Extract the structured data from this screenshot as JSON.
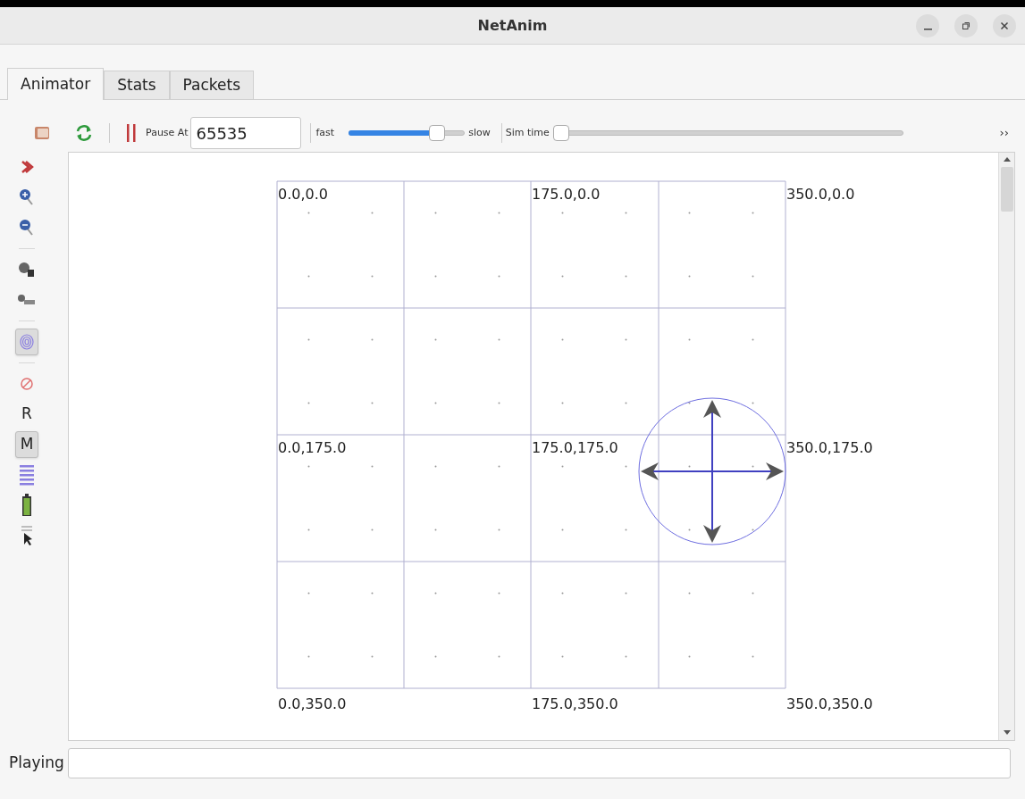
{
  "window": {
    "title": "NetAnim"
  },
  "tabs": [
    {
      "label": "Animator",
      "selected": true
    },
    {
      "label": "Stats",
      "selected": false
    },
    {
      "label": "Packets",
      "selected": false
    }
  ],
  "toolbar": {
    "pause_at": {
      "label": "Pause At",
      "value": "65535"
    },
    "speed": {
      "left_label": "fast",
      "right_label": "slow",
      "level": 0.8
    },
    "sim_time": {
      "label": "Sim time",
      "level": 0
    },
    "overflow": "››"
  },
  "sidebar": {
    "groups": [
      {
        "items": [
          {
            "kind": "chevron",
            "checked": false
          },
          {
            "kind": "zoom-in",
            "checked": false
          },
          {
            "kind": "zoom-out",
            "checked": false
          }
        ]
      },
      {
        "items": [
          {
            "kind": "node-id",
            "checked": false
          },
          {
            "kind": "ip",
            "checked": false
          }
        ]
      },
      {
        "items": [
          {
            "kind": "spiral",
            "checked": true
          }
        ]
      },
      {
        "items": [
          {
            "kind": "blocked",
            "checked": false
          },
          {
            "kind": "letter",
            "label": "R",
            "checked": false
          },
          {
            "kind": "letter",
            "label": "M",
            "checked": true
          },
          {
            "kind": "lines",
            "checked": false
          },
          {
            "kind": "battery",
            "checked": false
          },
          {
            "kind": "cursor",
            "checked": false
          }
        ]
      }
    ]
  },
  "canvas": {
    "coordinate_labels": [
      "0.0,0.0",
      "175.0,0.0",
      "350.0,0.0",
      "0.0,175.0",
      "175.0,175.0",
      "350.0,175.0",
      "0.0,350.0",
      "175.0,350.0",
      "350.0,350.0"
    ]
  },
  "status": {
    "label": "Playing"
  }
}
